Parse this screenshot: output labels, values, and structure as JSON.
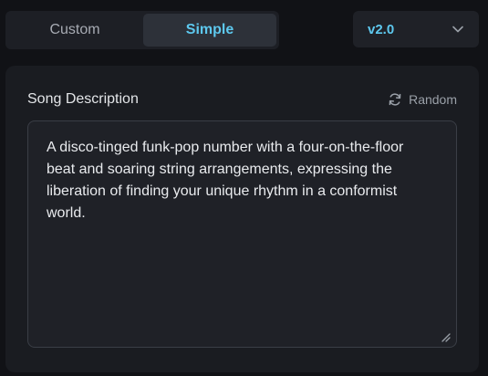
{
  "mode_toggle": {
    "tabs": [
      {
        "label": "Custom",
        "active": false
      },
      {
        "label": "Simple",
        "active": true
      }
    ]
  },
  "version_select": {
    "value": "v2.0",
    "icon": "chevron-down-icon"
  },
  "song_description": {
    "title": "Song Description",
    "random_label": "Random",
    "random_icon": "refresh-icon",
    "text": "A disco-tinged funk-pop number with a four-on-the-floor beat and soaring string arrangements, expressing the liberation of finding your unique rhythm in a conformist world."
  },
  "colors": {
    "accent": "#5dc8ee",
    "background": "#111216",
    "panel": "#1a1c21"
  }
}
